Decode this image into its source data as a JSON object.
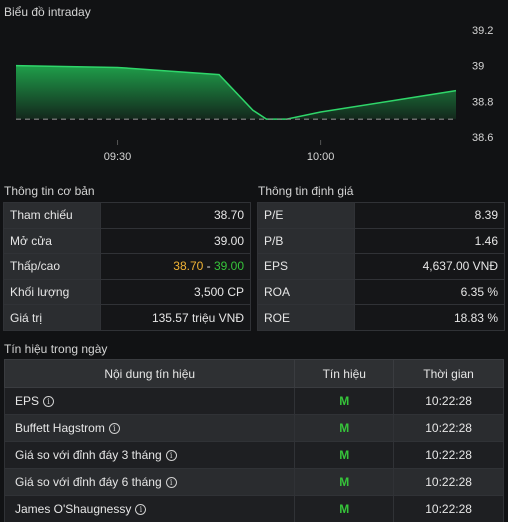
{
  "chart": {
    "title": "Biểu đồ intraday",
    "chart_data": {
      "type": "area",
      "x_ticks": [
        "09:30",
        "10:00"
      ],
      "y_ticks": [
        "39.2",
        "39",
        "38.8",
        "38.6"
      ],
      "ylim": [
        38.6,
        39.2
      ],
      "reference_price": 38.7,
      "series": [
        {
          "x": [
            "09:15",
            "09:30",
            "09:45",
            "09:50",
            "09:52",
            "09:55",
            "10:00",
            "10:10",
            "10:20"
          ],
          "values": [
            39.0,
            38.99,
            38.95,
            38.75,
            38.7,
            38.7,
            38.74,
            38.8,
            38.86
          ]
        }
      ],
      "colors": {
        "line": "#2fd66a",
        "fill_top": "#1f9e4a",
        "ref_line": "#8a8a8a"
      }
    }
  },
  "basic_info": {
    "title": "Thông tin cơ bản",
    "rows": [
      {
        "label": "Tham chiếu",
        "value": "38.70",
        "style": "ref"
      },
      {
        "label": "Mở cửa",
        "value": "39.00",
        "style": "up"
      },
      {
        "label": "Thấp/cao",
        "value_low": "38.70",
        "sep": " - ",
        "value_high": "39.00"
      },
      {
        "label": "Khối lượng",
        "value": "3,500 CP"
      },
      {
        "label": "Giá trị",
        "value": "135.57 triệu VNĐ"
      }
    ]
  },
  "valuation_info": {
    "title": "Thông tin định giá",
    "rows": [
      {
        "label": "P/E",
        "value": "8.39"
      },
      {
        "label": "P/B",
        "value": "1.46"
      },
      {
        "label": "EPS",
        "value": "4,637.00 VNĐ"
      },
      {
        "label": "ROA",
        "value": "6.35 %"
      },
      {
        "label": "ROE",
        "value": "18.83 %"
      }
    ]
  },
  "signals": {
    "title": "Tín hiệu trong ngày",
    "headers": [
      "Nội dung tín hiệu",
      "Tín hiệu",
      "Thời gian"
    ],
    "info_icon_glyph": "i",
    "rows": [
      {
        "name": "EPS",
        "signal": "M",
        "time": "10:22:28"
      },
      {
        "name": "Buffett Hagstrom",
        "signal": "M",
        "time": "10:22:28"
      },
      {
        "name": "Giá so với đỉnh đáy 3 tháng",
        "signal": "M",
        "time": "10:22:28"
      },
      {
        "name": "Giá so với đỉnh đáy 6 tháng",
        "signal": "M",
        "time": "10:22:28"
      },
      {
        "name": "James O'Shaugnessy",
        "signal": "M",
        "time": "10:22:28"
      }
    ]
  }
}
